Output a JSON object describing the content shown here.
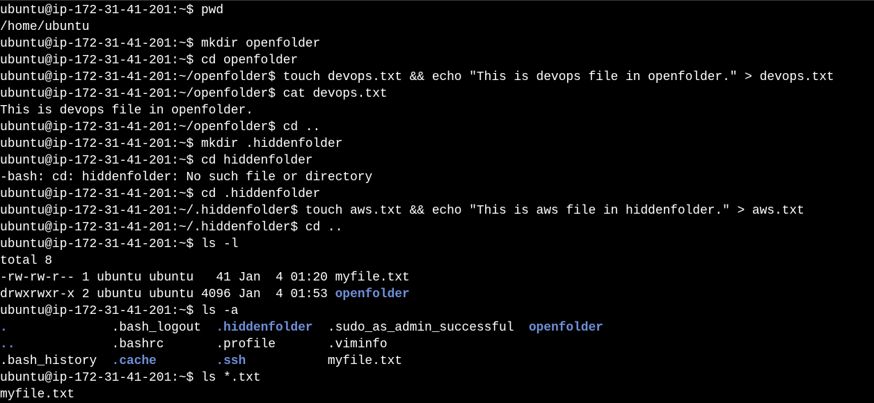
{
  "terminal": {
    "colors": {
      "background": "#000000",
      "foreground": "#ffffff",
      "directory": "#6f8fd8"
    },
    "lines": [
      [
        {
          "text": "ubuntu@ip-172-31-41-201:~$ pwd"
        }
      ],
      [
        {
          "text": "/home/ubuntu"
        }
      ],
      [
        {
          "text": "ubuntu@ip-172-31-41-201:~$ mkdir openfolder"
        }
      ],
      [
        {
          "text": "ubuntu@ip-172-31-41-201:~$ cd openfolder"
        }
      ],
      [
        {
          "text": "ubuntu@ip-172-31-41-201:~/openfolder$ touch devops.txt && echo \"This is devops file in openfolder.\" > devops.txt"
        }
      ],
      [
        {
          "text": "ubuntu@ip-172-31-41-201:~/openfolder$ cat devops.txt"
        }
      ],
      [
        {
          "text": "This is devops file in openfolder."
        }
      ],
      [
        {
          "text": "ubuntu@ip-172-31-41-201:~/openfolder$ cd .."
        }
      ],
      [
        {
          "text": "ubuntu@ip-172-31-41-201:~$ mkdir .hiddenfolder"
        }
      ],
      [
        {
          "text": "ubuntu@ip-172-31-41-201:~$ cd hiddenfolder"
        }
      ],
      [
        {
          "text": "-bash: cd: hiddenfolder: No such file or directory"
        }
      ],
      [
        {
          "text": "ubuntu@ip-172-31-41-201:~$ cd .hiddenfolder"
        }
      ],
      [
        {
          "text": "ubuntu@ip-172-31-41-201:~/.hiddenfolder$ touch aws.txt && echo \"This is aws file in hiddenfolder.\" > aws.txt"
        }
      ],
      [
        {
          "text": "ubuntu@ip-172-31-41-201:~/.hiddenfolder$ cd .."
        }
      ],
      [
        {
          "text": "ubuntu@ip-172-31-41-201:~$ ls -l"
        }
      ],
      [
        {
          "text": "total 8"
        }
      ],
      [
        {
          "text": "-rw-rw-r-- 1 ubuntu ubuntu   41 Jan  4 01:20 myfile.txt"
        }
      ],
      [
        {
          "text": "drwxrwxr-x 2 ubuntu ubuntu 4096 Jan  4 01:53 "
        },
        {
          "text": "openfolder",
          "dir": true
        }
      ],
      [
        {
          "text": "ubuntu@ip-172-31-41-201:~$ ls -a"
        }
      ],
      [
        {
          "text": ".",
          "dir": true
        },
        {
          "text": "              .bash_logout  "
        },
        {
          "text": ".hiddenfolder",
          "dir": true
        },
        {
          "text": "  .sudo_as_admin_successful  "
        },
        {
          "text": "openfolder",
          "dir": true
        }
      ],
      [
        {
          "text": "..",
          "dir": true
        },
        {
          "text": "             .bashrc       .profile       .viminfo"
        }
      ],
      [
        {
          "text": ".bash_history  "
        },
        {
          "text": ".cache",
          "dir": true
        },
        {
          "text": "        "
        },
        {
          "text": ".ssh",
          "dir": true
        },
        {
          "text": "           myfile.txt"
        }
      ],
      [
        {
          "text": "ubuntu@ip-172-31-41-201:~$ ls *.txt"
        }
      ],
      [
        {
          "text": "myfile.txt"
        }
      ]
    ]
  }
}
